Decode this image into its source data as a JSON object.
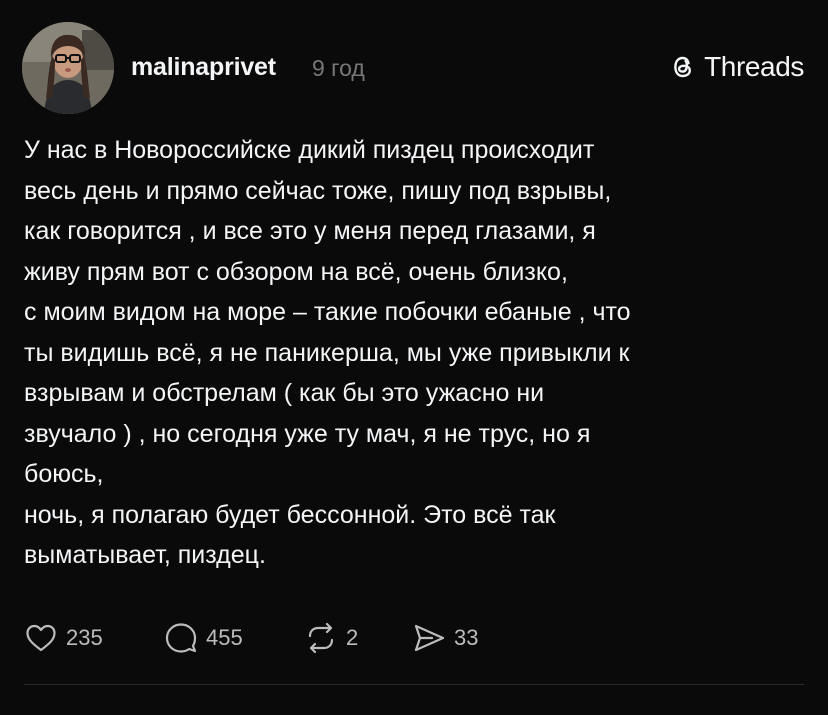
{
  "post": {
    "author": {
      "username": "malinaprivet",
      "time": "9 год"
    },
    "brand": {
      "name": "Threads",
      "icon": "threads-logo-icon"
    },
    "lines": [
      "У нас в Новороссийске дикий пиздец происходит",
      "весь день и прямо сейчас тоже, пишу под взрывы,",
      "как говорится , и все это у меня перед глазами, я",
      "живу прям вот с обзором на всё, очень близко,",
      "с моим видом на море – такие побочки ебаные , что",
      "ты видишь всё, я не паникерша, мы уже привыкли к",
      "взрывам и обстрелам ( как бы это ужасно ни",
      "звучало ) , но сегодня уже ту мач, я не трус, но я",
      "боюсь,",
      "ночь, я полагаю будет бессонной. Это всё так",
      "выматывает, пиздец."
    ],
    "actions": {
      "likes": "235",
      "comments": "455",
      "reposts": "2",
      "shares": "33"
    }
  },
  "colors": {
    "background": "#0a0a0a",
    "text": "#f3f5f7",
    "muted": "#777777",
    "action_text": "#bcbcbc"
  }
}
